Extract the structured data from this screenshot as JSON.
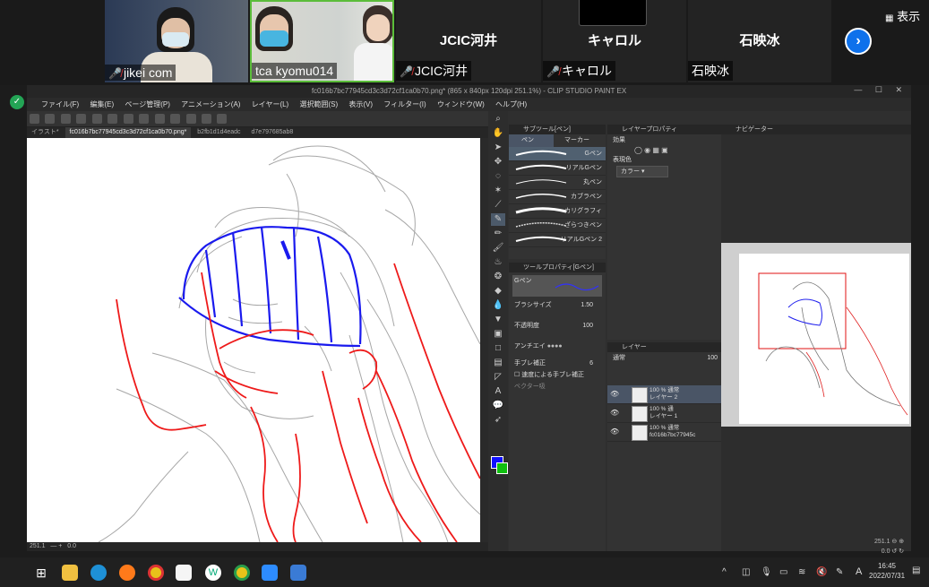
{
  "zoom": {
    "participants": [
      {
        "name": "jikei com",
        "muted": true
      },
      {
        "name": "tca kyomu014",
        "muted": false
      },
      {
        "name": "JCIC河井",
        "display": "JCIC河井",
        "muted": true
      },
      {
        "name": "キャロル",
        "display": "キャロル",
        "muted": true
      },
      {
        "name": "石映冰",
        "display": "石映冰",
        "muted": false
      }
    ],
    "view_label": "表示",
    "next_icon": "chevron-right-icon",
    "shield_icon": "shield-check-icon"
  },
  "app": {
    "title": "fc016b7bc77945cd3c3d72cf1ca0b70.png* (865 x 840px 120dpi 251.1%) - CLIP STUDIO PAINT EX",
    "menu": [
      "ファイル(F)",
      "編集(E)",
      "ページ管理(P)",
      "アニメーション(A)",
      "レイヤー(L)",
      "選択範囲(S)",
      "表示(V)",
      "フィルター(I)",
      "ウィンドウ(W)",
      "ヘルプ(H)"
    ],
    "tabs": [
      "イラスト*",
      "fc016b7bc77945cd3c3d72cf1ca0b70.png*",
      "b2fb1d1d4eadc",
      "d7e797685ab8"
    ],
    "status_zoom": "251.1",
    "status_angle": "0.0"
  },
  "subtool": {
    "header": "サブツール[ペン]",
    "tabs": [
      "ペン",
      "マーカー"
    ],
    "brushes": [
      "Gペン",
      "リアルGペン",
      "丸ペン",
      "カブラペン",
      "カリグラフィ",
      "ざらつきペン",
      "リアルGペン 2"
    ]
  },
  "toolprop": {
    "header": "ツールプロパティ[Gペン]",
    "preview_label": "Gペン",
    "brush_size_label": "ブラシサイズ",
    "brush_size_value": "1.50",
    "opacity_label": "不透明度",
    "opacity_value": "100",
    "aa_label": "アンチエイ",
    "stabilization_label": "手ブレ補正",
    "stabilization_value": "6",
    "speed_label": "速度による手ブレ補正",
    "vector_label": "ベクター吸"
  },
  "layerprop": {
    "header": "レイヤープロパティ",
    "effect_label": "効果",
    "expression_label": "表現色",
    "expression_value": "カラー"
  },
  "layers": {
    "header": "レイヤー",
    "blend": "通常",
    "opacity": "100",
    "items": [
      {
        "line1": "100 % 通常",
        "line2": "レイヤー 2"
      },
      {
        "line1": "100 % 通",
        "line2": "レイヤー 1"
      },
      {
        "line1": "100 % 通常",
        "line2": "fc016b7bc77945c"
      }
    ]
  },
  "navigator": {
    "header": "ナビゲーター",
    "zoom": "251.1",
    "angle": "0.0"
  },
  "taskbar": {
    "time": "16:45",
    "date": "2022/07/31",
    "ime": "A"
  },
  "colors": {
    "main_color": "#1010ff",
    "sub_color": "#10c010"
  }
}
